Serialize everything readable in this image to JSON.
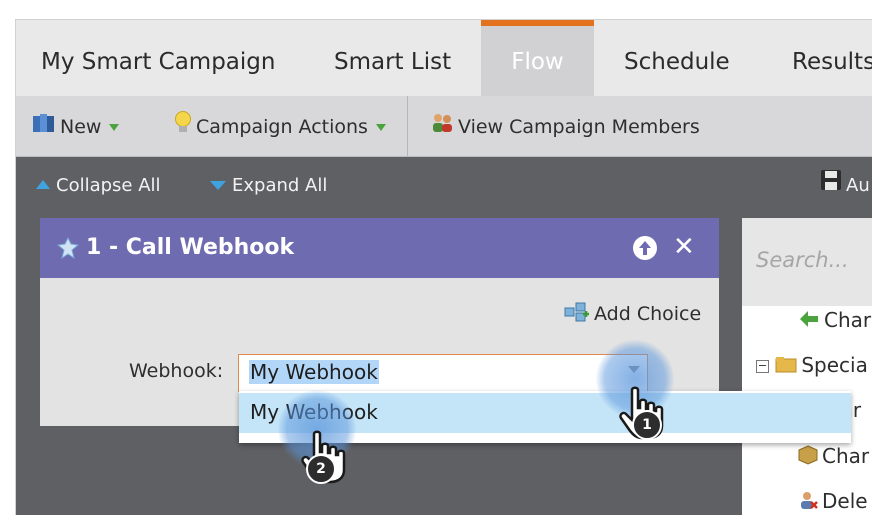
{
  "tabs": [
    {
      "label": "My Smart Campaign"
    },
    {
      "label": "Smart List"
    },
    {
      "label": "Flow"
    },
    {
      "label": "Schedule"
    },
    {
      "label": "Results"
    }
  ],
  "toolbar": {
    "new_label": "New",
    "campaign_actions_label": "Campaign Actions",
    "view_members_label": "View Campaign Members"
  },
  "actions": {
    "collapse_all": "Collapse All",
    "expand_all": "Expand All",
    "auto_save": "Au"
  },
  "flow_step": {
    "title": "1 - Call Webhook",
    "add_choice_label": "Add Choice",
    "webhook_label": "Webhook:",
    "webhook_value": "My Webhook"
  },
  "dropdown": {
    "options": [
      "My Webhook"
    ]
  },
  "right_panel": {
    "search_placeholder": "Search...",
    "items": [
      "Char",
      "Specia",
      "nar",
      "Char",
      "Dele"
    ]
  },
  "annotations": {
    "step1": "1",
    "step2": "2"
  },
  "colors": {
    "active_tab_accent": "#e3711e",
    "card_header": "#6e6bb0",
    "selection": "#c4e4f7"
  }
}
